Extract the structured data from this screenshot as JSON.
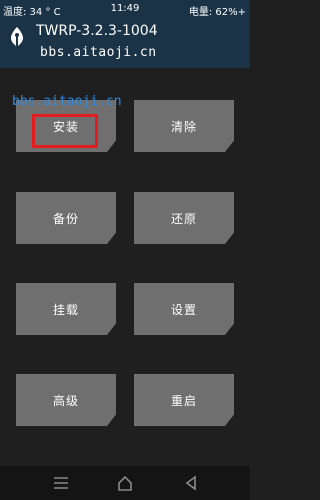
{
  "status_bar": {
    "temperature": "温度: 34 ° C",
    "time": "11:49",
    "battery": "电量: 62%+"
  },
  "header": {
    "title": "TWRP-3.2.3-1004",
    "subtitle": "bbs.aitaoji.cn"
  },
  "watermark": "bbs.aitaoji.cn",
  "menu": {
    "install": "安装",
    "wipe": "清除",
    "backup": "备份",
    "restore": "还原",
    "mount": "挂载",
    "settings": "设置",
    "advanced": "高级",
    "reboot": "重启"
  },
  "colors": {
    "header_bg": "#1b3347",
    "tile_bg": "#6f6f6f",
    "highlight": "#e31d1d",
    "watermark": "#2f8be0"
  },
  "nav_icons": [
    "menu-icon",
    "home-icon",
    "back-icon"
  ]
}
